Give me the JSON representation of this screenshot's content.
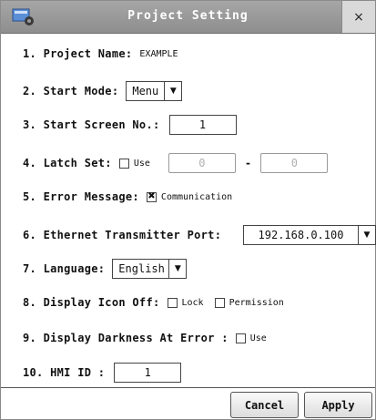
{
  "window": {
    "title": "Project Setting",
    "close_label": "×"
  },
  "rows": {
    "project_name": {
      "label": "1. Project Name:",
      "value": "EXAMPLE"
    },
    "start_mode": {
      "label": "2. Start Mode:",
      "value": "Menu"
    },
    "start_screen": {
      "label": "3. Start Screen No.:",
      "value": "1"
    },
    "latch_set": {
      "label": "4. Latch Set:",
      "checkbox_label": "Use",
      "checked": false,
      "from": "0",
      "separator": "-",
      "to": "0"
    },
    "error_message": {
      "label": "5. Error Message:",
      "checkbox_label": "Communication",
      "checked": true
    },
    "ethernet_port": {
      "label": "6. Ethernet Transmitter Port:",
      "value": "192.168.0.100"
    },
    "language": {
      "label": "7. Language:",
      "value": "English"
    },
    "display_icon_off": {
      "label": "8. Display Icon Off:",
      "lock_label": "Lock",
      "lock_checked": false,
      "permission_label": "Permission",
      "permission_checked": false
    },
    "display_darkness": {
      "label": "9. Display Darkness At Error :",
      "checkbox_label": "Use",
      "checked": false
    },
    "hmi_id": {
      "label": "10. HMI ID :",
      "value": "1"
    }
  },
  "buttons": {
    "cancel": "Cancel",
    "apply": "Apply"
  },
  "icons": {
    "title_icon": "settings-window-icon",
    "close": "close-icon",
    "dropdown": "chevron-down-icon",
    "check": "checkmark-icon"
  },
  "colors": {
    "titlebar": "#9a9a9a",
    "title_text": "#ffffff",
    "border": "#444444"
  }
}
